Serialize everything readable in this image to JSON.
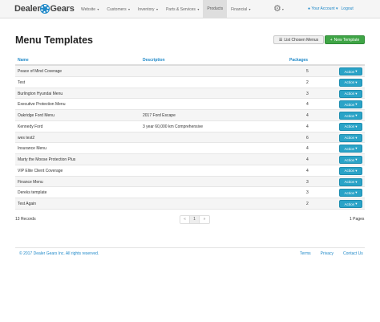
{
  "brand": {
    "name_left": "Dealer",
    "name_right": "Gears"
  },
  "nav": {
    "items": [
      {
        "label": "Website",
        "caret": "▾"
      },
      {
        "label": "Customers",
        "caret": "▾"
      },
      {
        "label": "Inventory",
        "caret": "▾"
      },
      {
        "label": "Parts & Services",
        "caret": "▾"
      },
      {
        "label": "Products",
        "caret": ""
      },
      {
        "label": "Financial",
        "caret": "▾"
      }
    ],
    "active": "Products",
    "account_label": "Your Account ▾",
    "logout_label": "Logout"
  },
  "page": {
    "title": "Menu Templates"
  },
  "buttons": {
    "list_chosen_menus": "List Chosen Menus",
    "new_template": "New Template",
    "action": "Action"
  },
  "table": {
    "headers": {
      "name": "Name",
      "description": "Description",
      "packages": "Packages"
    },
    "rows": [
      {
        "name": "Peace of Mind Coverage",
        "description": "",
        "packages": "5"
      },
      {
        "name": "Test",
        "description": "",
        "packages": "2"
      },
      {
        "name": "Burlington Hyundai Menu",
        "description": "",
        "packages": "3"
      },
      {
        "name": "Executive Protection Menu",
        "description": "",
        "packages": "4"
      },
      {
        "name": "Oakridge Ford Menu",
        "description": "2017 Ford Escape",
        "packages": "4"
      },
      {
        "name": "Kennedy Ford",
        "description": "3 year 60,000 km Comprehensive",
        "packages": "4"
      },
      {
        "name": "wes test2",
        "description": "",
        "packages": "6"
      },
      {
        "name": "Insurance Menu",
        "description": "",
        "packages": "4"
      },
      {
        "name": "Marty the Moose Protection Plus",
        "description": "",
        "packages": "4"
      },
      {
        "name": "VIP Elite Client Coverage",
        "description": "",
        "packages": "4"
      },
      {
        "name": "Finance Menu",
        "description": "",
        "packages": "3"
      },
      {
        "name": "Dereks template",
        "description": "",
        "packages": "3"
      },
      {
        "name": "Test Again",
        "description": "",
        "packages": "2"
      }
    ]
  },
  "summary": {
    "records": "13 Records",
    "pages": "1 Pages"
  },
  "pagination": {
    "prev": "«",
    "current": "1",
    "next": "»"
  },
  "footer": {
    "copyright": "© 2017 Dealer Gears Inc. All rights reserved.",
    "links": [
      "Terms",
      "Privacy",
      "Contact Us"
    ]
  },
  "colors": {
    "link": "#1e88c8",
    "action_button": "#2aa3c7",
    "new_button": "#3fa546"
  }
}
